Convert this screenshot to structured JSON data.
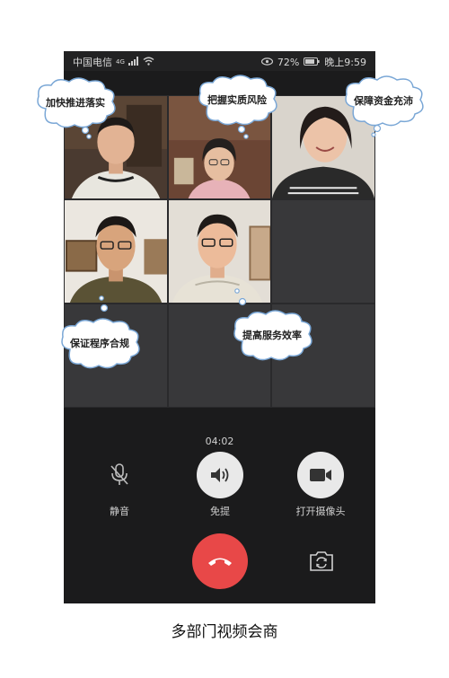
{
  "status_bar": {
    "carrier": "中国电信",
    "signal_tag": "4G",
    "battery_percent": "72%",
    "time": "晚上9:59"
  },
  "bubbles": [
    {
      "text": "加快推进落实"
    },
    {
      "text": "把握实质风险"
    },
    {
      "text": "保障资金充沛"
    },
    {
      "text": "保证程序合规"
    },
    {
      "text": "提高服务效率"
    }
  ],
  "call": {
    "duration": "04:02",
    "mute_label": "静音",
    "speaker_label": "免提",
    "camera_label": "打开摄像头",
    "hangup_color": "#e84848",
    "switch_camera_icon": "camera-switch-icon"
  },
  "caption": "多部门视频会商"
}
